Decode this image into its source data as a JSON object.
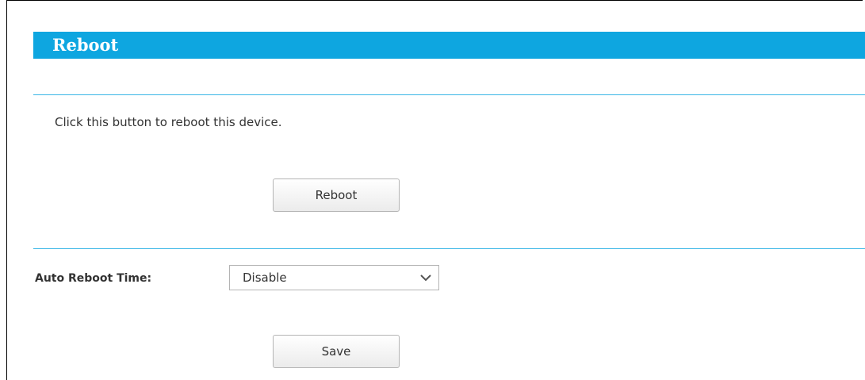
{
  "page": {
    "title": "Reboot",
    "description": "Click this button to reboot this device."
  },
  "buttons": {
    "reboot_label": "Reboot",
    "save_label": "Save"
  },
  "auto_reboot": {
    "label": "Auto Reboot Time:",
    "selected": "Disable"
  },
  "colors": {
    "header_bg": "#0ea6e0",
    "rule": "#38b6e6"
  }
}
